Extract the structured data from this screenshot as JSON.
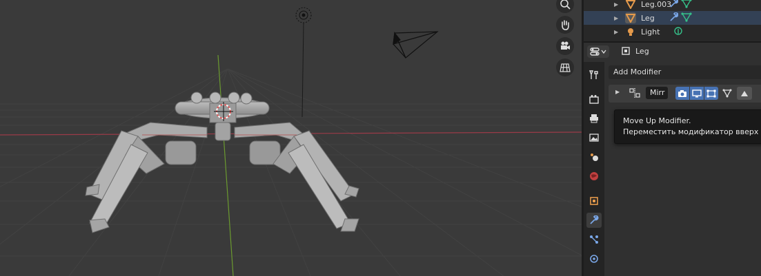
{
  "outliner": {
    "items": [
      {
        "label": "Leg.003",
        "icon": "mesh-object-icon",
        "modifier_icon": "wrench-icon",
        "data_icon": "mesh-data-icon"
      },
      {
        "label": "Leg",
        "icon": "mesh-object-icon",
        "modifier_icon": "wrench-icon",
        "data_icon": "mesh-data-icon"
      },
      {
        "label": "Light",
        "icon": "light-object-icon",
        "data_icon": "light-data-icon"
      }
    ]
  },
  "properties": {
    "object_name": "Leg",
    "add_modifier_label": "Add Modifier",
    "modifier": {
      "name": "Mirr",
      "type_icon": "mirror-modifier-icon",
      "show_render": true,
      "show_viewport": true,
      "show_edit_mode": true
    },
    "tabs": [
      "tool",
      "render",
      "output",
      "view-layer",
      "scene",
      "world",
      "object",
      "modifiers",
      "particles",
      "physics"
    ],
    "active_tab": "modifiers"
  },
  "tooltip": {
    "title": "Move Up Modifier.",
    "description": "Переместить модификатор вверх по с"
  },
  "colors": {
    "selection_blue": "#4772b3",
    "mesh_orange": "#e59a4b",
    "data_green": "#35c18a",
    "y_axis_green": "#6b9a2f",
    "x_axis_red": "#9b3a48"
  }
}
